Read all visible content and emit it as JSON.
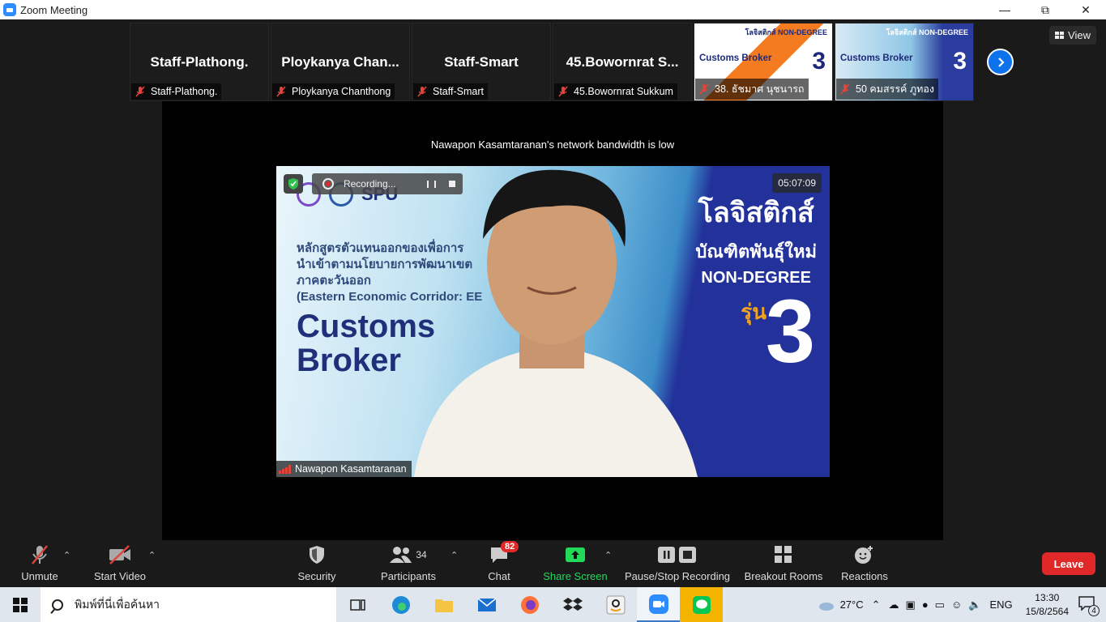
{
  "window": {
    "title": "Zoom Meeting"
  },
  "gallery": {
    "tiles": [
      {
        "name": "Staff-Plathong.",
        "label": "Staff-Plathong."
      },
      {
        "name": "Ploykanya  Chan...",
        "label": "Ploykanya Chanthong"
      },
      {
        "name": "Staff-Smart",
        "label": "Staff-Smart"
      },
      {
        "name": "45.Bowornrat  S...",
        "label": "45.Bowornrat Sukkum"
      }
    ],
    "video_tiles": [
      {
        "label": "38. ธัชมาศ นุชนารถ",
        "headline": "Customs Broker",
        "header": "โลจิสติกส์ NON-DEGREE",
        "num": "3"
      },
      {
        "label": "50 คมสรรค์ ภูทอง",
        "headline": "Customs Broker",
        "header": "โลจิสติกส์ NON-DEGREE",
        "num": "3"
      }
    ],
    "view_label": "View"
  },
  "speaker": {
    "notice": "Nawapon Kasamtaranan's network bandwidth is low",
    "name": "Nawapon Kasamtaranan",
    "recording_label": "Recording...",
    "timer": "05:07:09",
    "slide": {
      "logo_text": "SPU",
      "thai_sub_1": "หลักสูตรตัวแทนออกของเพื่อการ",
      "thai_sub_2": "นำเข้าตามนโยบายการพัฒนาเขต",
      "thai_sub_3": "ภาคตะวันออก",
      "thai_sub_4": "(Eastern Economic Corridor: EE",
      "headline_1": "Customs",
      "headline_2": "Broker",
      "right_1": "โลจิสติกส์",
      "right_2": "บัณฑิตพันธุ์ใหม่",
      "right_3": "NON-DEGREE",
      "rune": "รุ่น",
      "number": "3"
    }
  },
  "toolbar": {
    "unmute": "Unmute",
    "start_video": "Start Video",
    "security": "Security",
    "participants": "Participants",
    "participants_count": "34",
    "chat": "Chat",
    "chat_badge": "82",
    "share_screen": "Share Screen",
    "pause_stop_recording": "Pause/Stop Recording",
    "breakout_rooms": "Breakout Rooms",
    "reactions": "Reactions",
    "leave": "Leave",
    "share_color": "#23d959",
    "leave_color": "#e02828"
  },
  "taskbar": {
    "search_placeholder": "พิมพ์ที่นี่เพื่อค้นหา",
    "weather": "27°C",
    "lang": "ENG",
    "time": "13:30",
    "date": "15/8/2564",
    "notifications": "4"
  }
}
